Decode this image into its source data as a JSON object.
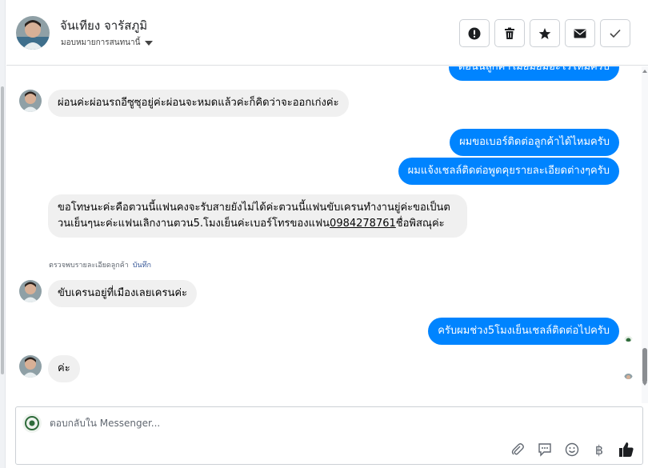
{
  "header": {
    "contact_name": "จันเทียง จารัสภูมิ",
    "assign_label": "มอบหมายการสนทนานี้",
    "actions": [
      {
        "name": "report-button",
        "icon": "exclamation-circle-icon"
      },
      {
        "name": "delete-button",
        "icon": "trash-icon"
      },
      {
        "name": "star-button",
        "icon": "star-icon"
      },
      {
        "name": "mark-unread-button",
        "icon": "envelope-icon"
      },
      {
        "name": "mark-done-button",
        "icon": "checkmark-icon"
      }
    ]
  },
  "messages": {
    "m0": "ต่อนี้นลูกค้าไม่ยิ่มยิ่มอะไรไหมครับ",
    "m1": "ผ่อนค่ะผ่อนรถอีซูซุอยู่ค่ะผ่อนจะหมดแล้วค่ะก็คิดว่าจะออกเก่งค่ะ",
    "m2": "ผมขอเบอร์ติดต่อลูกค้าได้ไหมครับ",
    "m3": "ผมแจ้งเชลล์ติดต่อพูดคุยรายละเอียดต่างๆครับ",
    "m4_part1": "ขอโทษนะค่ะคือตวนนี้แฟนคงจะรับสายยังไม่ได้ค่ะตวนนี้แฟนขับเครนทำงานยู่ค่ะขอเป็นตวนเย็นๆนะค่ะแฟนเลิกงานตวน5.โมงเย็นค่ะเบอร์โทรของแฟน",
    "m4_phone": "0984278761",
    "m4_part2": "ชื่อพิสณุค่ะ",
    "m5": "ขับเครนอยู่ที่เมืองเลยเครนค่ะ",
    "m6": "ครับผมช่วง5โมงเย็นเชลล์ติดต่อไปครับ",
    "m7": "ค่ะ"
  },
  "note": {
    "text": "ตรวจพบรายละเอียดลูกค้า",
    "link": "บันทึก"
  },
  "composer": {
    "placeholder": "ตอบกลับใน Messenger...",
    "tools": [
      "paperclip-icon",
      "saved-reply-icon",
      "emoji-icon",
      "baht-icon",
      "thumbs-up-icon"
    ]
  },
  "colors": {
    "outgoing": "#0084ff",
    "incoming": "#f0f0f0",
    "link": "#385898"
  }
}
